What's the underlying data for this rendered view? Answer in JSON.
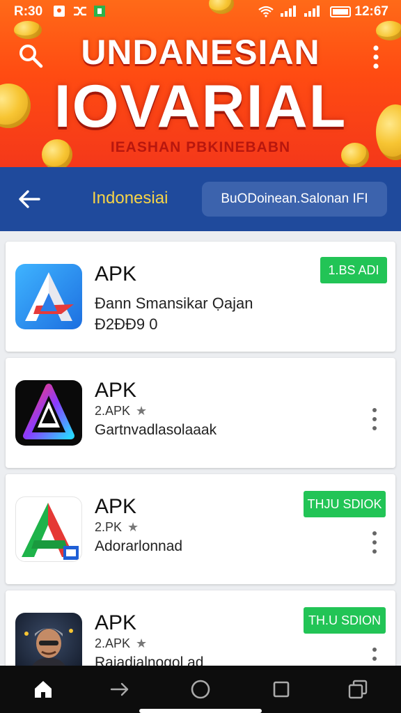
{
  "status_bar": {
    "time_left": "R:30",
    "time_right": "12:67"
  },
  "banner": {
    "line1": "UNDANESIAN",
    "line2": "IOVARIAL",
    "line3": "IEASHAN PBKINEBABN"
  },
  "navbar": {
    "title": "Indonesiai",
    "field_value": "BuODoinean.Salonan IFI"
  },
  "apps": [
    {
      "name": "APK",
      "line1": "Đann Smansikar Ọajan",
      "line2": "Đ2ĐĐ9 0",
      "action": "1.BS ADI",
      "icon": "a-blue-red-logo-icon"
    },
    {
      "name": "APK",
      "rating": "2.APK",
      "desc": "Gartnvadlasolaaak",
      "icon": "a-rainbow-dark-logo-icon"
    },
    {
      "name": "APK",
      "rating": "2.PK",
      "desc": "Adorarlonnad",
      "action": "THJU SDIOK",
      "icon": "a-green-red-logo-icon"
    },
    {
      "name": "APK",
      "rating": "2.APK",
      "desc": "Rajadialnogol ad",
      "action": "TH.U SDION",
      "icon": "man-portrait-icon"
    }
  ],
  "colors": {
    "banner_orange": "#ff5a14",
    "nav_blue": "#1f4a9c",
    "nav_title_yellow": "#f7d447",
    "action_green": "#22c456"
  }
}
